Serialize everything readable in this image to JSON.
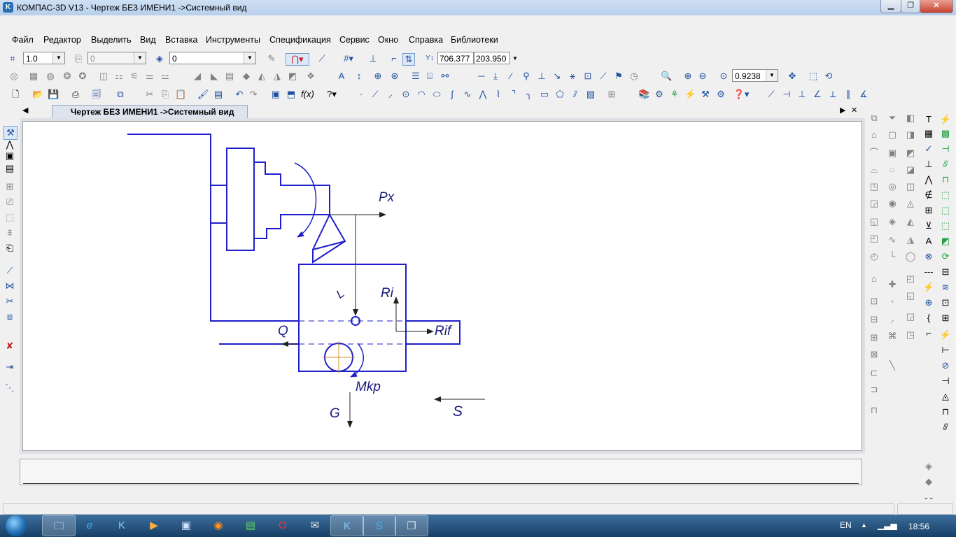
{
  "window": {
    "title": "КОМПАС-3D V13 - Чертеж БЕЗ ИМЕНИ1 ->Системный вид",
    "minimize": "▁",
    "maximize": "❐",
    "close": "✕"
  },
  "menu": {
    "items": [
      "Файл",
      "Редактор",
      "Выделить",
      "Вид",
      "Вставка",
      "Инструменты",
      "Спецификация",
      "Сервис",
      "Окно",
      "Справка",
      "Библиотеки"
    ]
  },
  "toolbar1": {
    "scale_value": "1.0",
    "style_value": "0",
    "layer_value": "0",
    "coord_x": "706.377",
    "coord_y": "203.950"
  },
  "toolbar2": {
    "zoom_value": "0.9238"
  },
  "tab": {
    "title": "Чертеж БЕЗ ИМЕНИ1 ->Системный вид",
    "nav_left": "◀",
    "nav_right": "▶",
    "close": "✕"
  },
  "drawing": {
    "labels": {
      "px": "Px",
      "ri": "Ri",
      "rif": "Rif",
      "q": "Q",
      "l": "L",
      "mkp": "Mkp",
      "g": "G",
      "s": "S"
    },
    "line_color": "#1f1fcc",
    "center_color": "#d09020"
  },
  "taskbar": {
    "lang": "EN",
    "time": "18:56",
    "tray_arrow": "▲"
  }
}
